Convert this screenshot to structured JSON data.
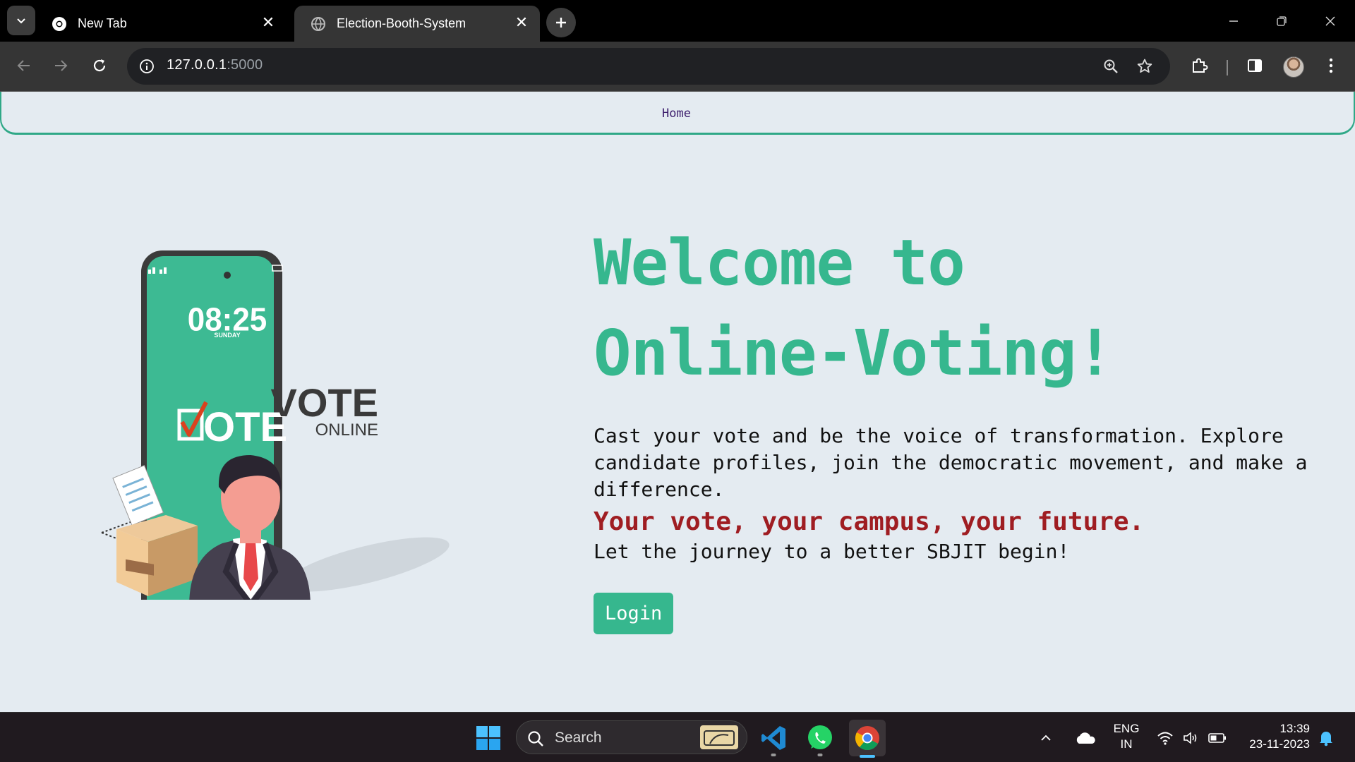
{
  "browser": {
    "tabs": [
      {
        "title": "New Tab",
        "active": false
      },
      {
        "title": "Election-Booth-System",
        "active": true
      }
    ],
    "url_host": "127.0.0.1",
    "url_port": ":5000"
  },
  "navbar": {
    "home": "Home"
  },
  "illustration": {
    "phone_time": "08:25",
    "phone_day": "SUNDAY",
    "phone_vote": "OTE",
    "vote_title": "VOTE",
    "vote_sub": "ONLINE"
  },
  "hero": {
    "title_line1": "Welcome to",
    "title_line2": "Online-Voting!",
    "description": "Cast your vote and be the voice of transformation. Explore candidate profiles, join the democratic movement, and make a difference.",
    "tagline": "Your vote, your campus, your future.",
    "subline": "Let the journey to a better SBJIT begin!",
    "login_label": "Login"
  },
  "taskbar": {
    "search_label": "Search",
    "lang_line1": "ENG",
    "lang_line2": "IN",
    "time": "13:39",
    "date": "23-11-2023"
  },
  "colors": {
    "accent": "#36b78e",
    "tagline": "#9f1d22",
    "page_bg": "#e4ebf1"
  }
}
